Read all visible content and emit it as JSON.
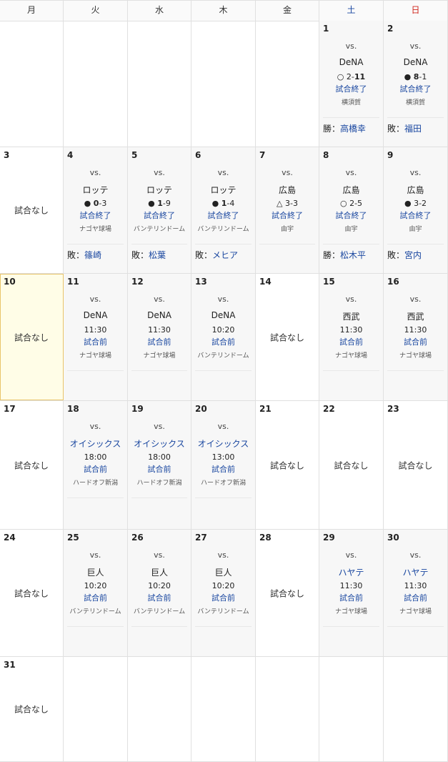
{
  "weekdays": [
    "月",
    "火",
    "水",
    "木",
    "金",
    "土",
    "日"
  ],
  "no_game_label": "試合なし",
  "vs_label": "vs.",
  "colors": {
    "saturday": "#1a47a0",
    "sunday": "#d0261c",
    "link": "#1a47a0",
    "today_bg": "#fffde7"
  },
  "weeks": [
    [
      {
        "day": "",
        "type": "blank"
      },
      {
        "day": "",
        "type": "blank"
      },
      {
        "day": "",
        "type": "blank"
      },
      {
        "day": "",
        "type": "blank"
      },
      {
        "day": "",
        "type": "blank"
      },
      {
        "day": "1",
        "type": "game",
        "opponent": "DeNA",
        "opponent_link": false,
        "result_mark": "○",
        "score_left": "2",
        "score_sep": "-",
        "score_right": "11",
        "bold": "right",
        "status": "試合終了",
        "venue": "横須賀",
        "pitcher_label": "勝：",
        "pitcher_name": "高橋幸"
      },
      {
        "day": "2",
        "type": "game",
        "opponent": "DeNA",
        "opponent_link": false,
        "result_mark": "●",
        "score_left": "8",
        "score_sep": "-",
        "score_right": "1",
        "bold": "left",
        "status": "試合終了",
        "venue": "横須賀",
        "pitcher_label": "敗：",
        "pitcher_name": "福田"
      }
    ],
    [
      {
        "day": "3",
        "type": "nogame"
      },
      {
        "day": "4",
        "type": "game",
        "opponent": "ロッテ",
        "opponent_link": false,
        "result_mark": "●",
        "score_left": "0",
        "score_sep": "-",
        "score_right": "3",
        "bold": "left",
        "status": "試合終了",
        "venue": "ナゴヤ球場",
        "pitcher_label": "敗：",
        "pitcher_name": "篠崎"
      },
      {
        "day": "5",
        "type": "game",
        "opponent": "ロッテ",
        "opponent_link": false,
        "result_mark": "●",
        "score_left": "1",
        "score_sep": "-",
        "score_right": "9",
        "bold": "left",
        "status": "試合終了",
        "venue": "バンテリンドーム",
        "pitcher_label": "敗：",
        "pitcher_name": "松葉"
      },
      {
        "day": "6",
        "type": "game",
        "opponent": "ロッテ",
        "opponent_link": false,
        "result_mark": "●",
        "score_left": "1",
        "score_sep": "-",
        "score_right": "4",
        "bold": "left",
        "status": "試合終了",
        "venue": "バンテリンドーム",
        "pitcher_label": "敗：",
        "pitcher_name": "メヒア"
      },
      {
        "day": "7",
        "type": "game",
        "opponent": "広島",
        "opponent_link": false,
        "result_mark": "△",
        "score_left": "3",
        "score_sep": "-",
        "score_right": "3",
        "bold": "none",
        "status": "試合終了",
        "venue": "由宇",
        "pitcher_label": "",
        "pitcher_name": ""
      },
      {
        "day": "8",
        "type": "game",
        "opponent": "広島",
        "opponent_link": false,
        "result_mark": "○",
        "score_left": "2",
        "score_sep": "-",
        "score_right": "5",
        "bold": "none",
        "status": "試合終了",
        "venue": "由宇",
        "pitcher_label": "勝：",
        "pitcher_name": "松木平"
      },
      {
        "day": "9",
        "type": "game",
        "opponent": "広島",
        "opponent_link": false,
        "result_mark": "●",
        "score_left": "3",
        "score_sep": "-",
        "score_right": "2",
        "bold": "none",
        "status": "試合終了",
        "venue": "由宇",
        "pitcher_label": "敗：",
        "pitcher_name": "宮内"
      }
    ],
    [
      {
        "day": "10",
        "type": "nogame",
        "today": true
      },
      {
        "day": "11",
        "type": "game",
        "opponent": "DeNA",
        "opponent_link": false,
        "time": "11:30",
        "status": "試合前",
        "venue": "ナゴヤ球場"
      },
      {
        "day": "12",
        "type": "game",
        "opponent": "DeNA",
        "opponent_link": false,
        "time": "11:30",
        "status": "試合前",
        "venue": "ナゴヤ球場"
      },
      {
        "day": "13",
        "type": "game",
        "opponent": "DeNA",
        "opponent_link": false,
        "time": "10:20",
        "status": "試合前",
        "venue": "バンテリンドーム"
      },
      {
        "day": "14",
        "type": "nogame"
      },
      {
        "day": "15",
        "type": "game",
        "opponent": "西武",
        "opponent_link": false,
        "time": "11:30",
        "status": "試合前",
        "venue": "ナゴヤ球場"
      },
      {
        "day": "16",
        "type": "game",
        "opponent": "西武",
        "opponent_link": false,
        "time": "11:30",
        "status": "試合前",
        "venue": "ナゴヤ球場"
      }
    ],
    [
      {
        "day": "17",
        "type": "nogame"
      },
      {
        "day": "18",
        "type": "game",
        "opponent": "オイシックス",
        "opponent_link": true,
        "time": "18:00",
        "status": "試合前",
        "venue": "ハードオフ新潟"
      },
      {
        "day": "19",
        "type": "game",
        "opponent": "オイシックス",
        "opponent_link": true,
        "time": "18:00",
        "status": "試合前",
        "venue": "ハードオフ新潟"
      },
      {
        "day": "20",
        "type": "game",
        "opponent": "オイシックス",
        "opponent_link": true,
        "time": "13:00",
        "status": "試合前",
        "venue": "ハードオフ新潟"
      },
      {
        "day": "21",
        "type": "nogame"
      },
      {
        "day": "22",
        "type": "nogame"
      },
      {
        "day": "23",
        "type": "nogame"
      }
    ],
    [
      {
        "day": "24",
        "type": "nogame"
      },
      {
        "day": "25",
        "type": "game",
        "opponent": "巨人",
        "opponent_link": false,
        "time": "10:20",
        "status": "試合前",
        "venue": "バンテリンドーム"
      },
      {
        "day": "26",
        "type": "game",
        "opponent": "巨人",
        "opponent_link": false,
        "time": "10:20",
        "status": "試合前",
        "venue": "バンテリンドーム"
      },
      {
        "day": "27",
        "type": "game",
        "opponent": "巨人",
        "opponent_link": false,
        "time": "10:20",
        "status": "試合前",
        "venue": "バンテリンドーム"
      },
      {
        "day": "28",
        "type": "nogame"
      },
      {
        "day": "29",
        "type": "game",
        "opponent": "ハヤテ",
        "opponent_link": true,
        "time": "11:30",
        "status": "試合前",
        "venue": "ナゴヤ球場"
      },
      {
        "day": "30",
        "type": "game",
        "opponent": "ハヤテ",
        "opponent_link": true,
        "time": "11:30",
        "status": "試合前",
        "venue": "ナゴヤ球場"
      }
    ],
    [
      {
        "day": "31",
        "type": "nogame"
      },
      {
        "day": "",
        "type": "blank"
      },
      {
        "day": "",
        "type": "blank"
      },
      {
        "day": "",
        "type": "blank"
      },
      {
        "day": "",
        "type": "blank"
      },
      {
        "day": "",
        "type": "blank"
      },
      {
        "day": "",
        "type": "blank"
      }
    ]
  ]
}
